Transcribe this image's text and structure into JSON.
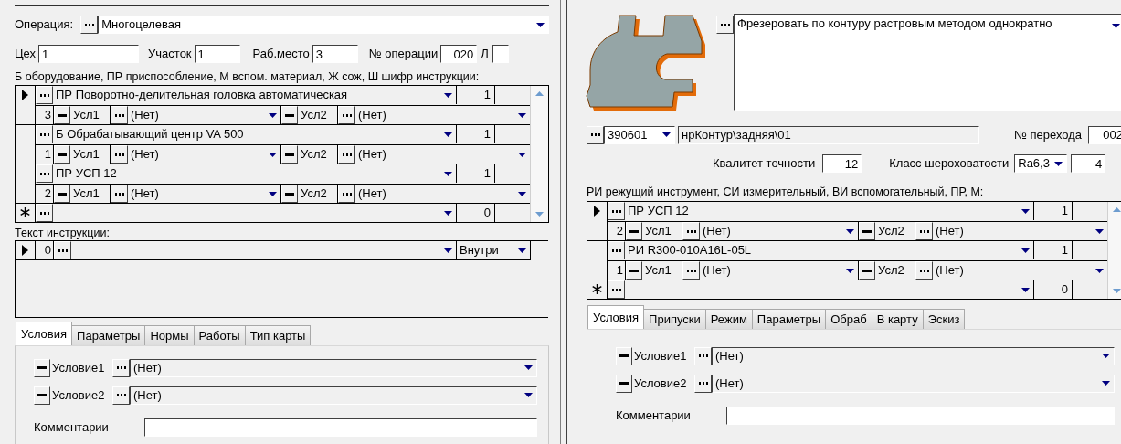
{
  "operation_panel": {
    "operation": {
      "label": "Операция:",
      "value": "Многоцелевая"
    },
    "fields": [
      {
        "label": "Цех",
        "value": "1"
      },
      {
        "label": "Участок",
        "value": "1"
      },
      {
        "label": "Раб.место",
        "value": "3"
      },
      {
        "label": "№ операции",
        "value": "020",
        "suffix": "Л"
      }
    ],
    "equipment": {
      "caption": "Б оборудование, ПР приспособление, М вспом. материал, Ж сож, Ш шифр инструкции:",
      "rows": [
        {
          "current": true,
          "name": "ПР Поворотно-делительная головка автоматическая",
          "qty": "1",
          "number": "3",
          "cond1": {
            "label": "Усл1",
            "value": "(Нет)"
          },
          "cond2": {
            "label": "Усл2",
            "value": "(Нет)"
          }
        },
        {
          "current": false,
          "name": "Б Обрабатывающий центр VA 500",
          "qty": "1",
          "number": "1",
          "cond1": {
            "label": "Усл1",
            "value": "(Нет)"
          },
          "cond2": {
            "label": "Усл2",
            "value": "(Нет)"
          }
        },
        {
          "current": false,
          "name": "ПР УСП 12",
          "qty": "1",
          "number": "2",
          "cond1": {
            "label": "Усл1",
            "value": "(Нет)"
          },
          "cond2": {
            "label": "Усл2",
            "value": "(Нет)"
          }
        }
      ],
      "new_row": {
        "qty": "0"
      }
    },
    "instruction": {
      "caption": "Текст инструкции:",
      "rows": [
        {
          "current": true,
          "number": "0",
          "place": "Внутри"
        }
      ]
    },
    "tabs": [
      {
        "label": "Условия",
        "selected": true
      },
      {
        "label": "Параметры",
        "selected": false
      },
      {
        "label": "Нормы",
        "selected": false
      },
      {
        "label": "Работы",
        "selected": false
      },
      {
        "label": "Тип карты",
        "selected": false
      }
    ],
    "conditions": [
      {
        "label": "Условие1",
        "value": "(Нет)"
      },
      {
        "label": "Условие2",
        "value": "(Нет)"
      }
    ],
    "comment": {
      "label": "Комментарии"
    }
  },
  "transition_panel": {
    "transition": {
      "value": "Фрезеровать по контуру растровым методом однократно"
    },
    "program": {
      "code": "390601",
      "path": "нрКонтур\\задняя\\01"
    },
    "transition_number": {
      "label": "№ перехода",
      "value": "002"
    },
    "accuracy": {
      "label": "Квалитет точности",
      "value": "12"
    },
    "roughness": {
      "label": "Класс шероховатости",
      "value": "Ra6,3",
      "extra": "4"
    },
    "tools": {
      "caption": "РИ режущий инструмент, СИ измерительный, ВИ вспомогательный, ПР, М:",
      "rows": [
        {
          "current": true,
          "name": "ПР УСП 12",
          "qty": "1",
          "number": "2",
          "cond1": {
            "label": "Усл1",
            "value": "(Нет)"
          },
          "cond2": {
            "label": "Усл2",
            "value": "(Нет)"
          }
        },
        {
          "current": false,
          "name": "РИ R300-010A16L-05L",
          "qty": "1",
          "number": "1",
          "cond1": {
            "label": "Усл1",
            "value": "(Нет)"
          },
          "cond2": {
            "label": "Усл2",
            "value": "(Нет)"
          }
        }
      ],
      "new_row": {
        "qty": "0"
      }
    },
    "tabs": [
      {
        "label": "Условия",
        "selected": true
      },
      {
        "label": "Припуски",
        "selected": false
      },
      {
        "label": "Режим",
        "selected": false
      },
      {
        "label": "Параметры",
        "selected": false
      },
      {
        "label": "Обраб",
        "selected": false
      },
      {
        "label": "В карту",
        "selected": false
      },
      {
        "label": "Эскиз",
        "selected": false
      }
    ],
    "conditions": [
      {
        "label": "Условие1",
        "value": "(Нет)"
      },
      {
        "label": "Условие2",
        "value": "(Нет)"
      }
    ],
    "comment": {
      "label": "Комментарии"
    }
  }
}
